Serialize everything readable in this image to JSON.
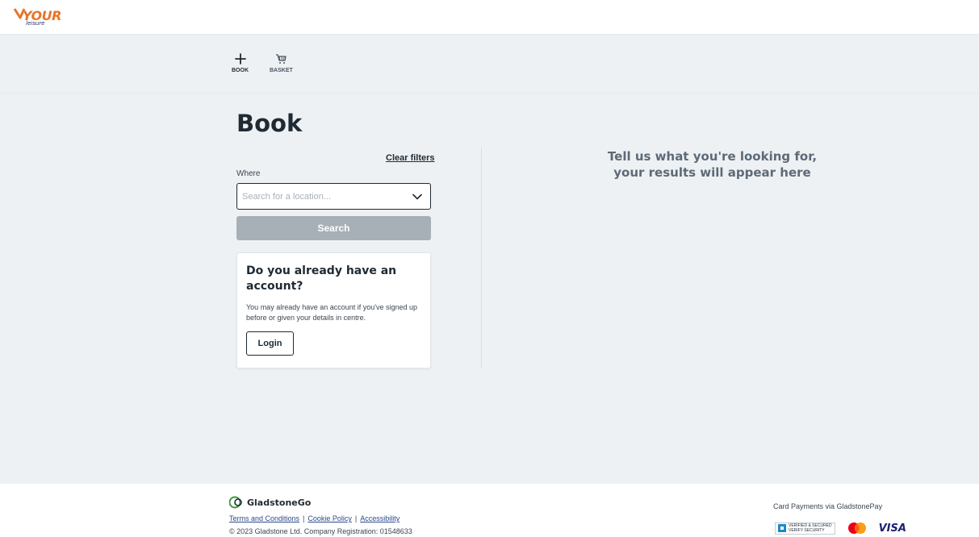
{
  "brand": {
    "logo_text": "YOUR",
    "logo_sub": "leisure",
    "accent_color": "#e8742a"
  },
  "nav": {
    "items": [
      {
        "label": "BOOK",
        "icon": "plus-icon"
      },
      {
        "label": "BASKET",
        "icon": "basket-icon"
      }
    ]
  },
  "page": {
    "title": "Book"
  },
  "filters": {
    "clear_label": "Clear filters",
    "where_label": "Where",
    "where_placeholder": "Search for a location...",
    "where_value": "",
    "search_label": "Search"
  },
  "account_card": {
    "title": "Do you already have an account?",
    "text": "You may already have an account if you've signed up before or given your details in centre.",
    "login_label": "Login"
  },
  "results": {
    "message_line1": "Tell us what you're looking for,",
    "message_line2": "your results will appear here"
  },
  "footer": {
    "brand": "GladstoneGo",
    "links": [
      "Terms and Conditions",
      "Cookie Policy",
      "Accessibility"
    ],
    "separator": "|",
    "copyright": "© 2023 Gladstone Ltd. Company Registration: 01548633",
    "payments_label": "Card Payments via GladstonePay",
    "verified_line1": "VERIFIED & SECURED",
    "verified_line2": "VERIFY SECURITY",
    "visa_label": "VISA"
  }
}
